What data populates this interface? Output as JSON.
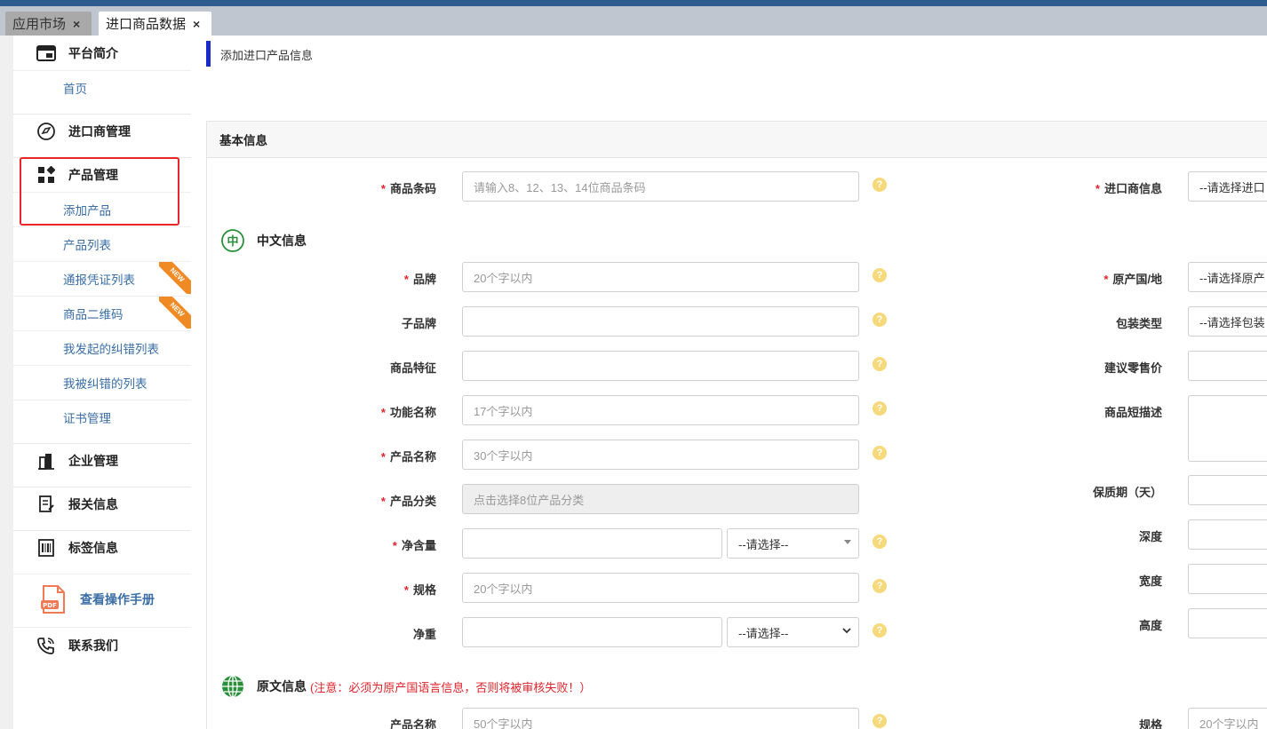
{
  "tabs": [
    {
      "label": "应用市场",
      "close": "×"
    },
    {
      "label": "进口商品数据",
      "close": "×"
    }
  ],
  "sidebar": {
    "sections": [
      {
        "label": "平台简介",
        "icon": "layout-window-icon"
      },
      {
        "label": "进口商管理",
        "icon": "compass-circle-icon"
      },
      {
        "label": "产品管理",
        "icon": "grid-blocks-icon"
      },
      {
        "label": "企业管理",
        "icon": "building-icon"
      },
      {
        "label": "报关信息",
        "icon": "document-pen-icon"
      },
      {
        "label": "标签信息",
        "icon": "barcode-icon"
      },
      {
        "label": "联系我们",
        "icon": "phone-icon"
      }
    ],
    "items": {
      "home": "首页",
      "add_product": "添加产品",
      "product_list": "产品列表",
      "notice_list": "通报凭证列表",
      "qrcode": "商品二维码",
      "my_corrections": "我发起的纠错列表",
      "corrected_me": "我被纠错的列表",
      "certificates": "证书管理"
    },
    "badge_new": "NEW",
    "manual": "查看操作手册",
    "manual_icon_text": "PDF"
  },
  "main": {
    "title": "添加进口产品信息",
    "section_title": "基本信息",
    "help_glyph": "?",
    "required_mark": "*",
    "left_fields": {
      "barcode": {
        "label": "商品条码",
        "placeholder": "请输入8、12、13、14位商品条码"
      },
      "brand": {
        "label": "品牌",
        "placeholder": "20个字以内"
      },
      "sub_brand": {
        "label": "子品牌",
        "placeholder": ""
      },
      "feature": {
        "label": "商品特征",
        "placeholder": ""
      },
      "func_name": {
        "label": "功能名称",
        "placeholder": "17个字以内"
      },
      "product_name": {
        "label": "产品名称",
        "placeholder": "30个字以内"
      },
      "category": {
        "label": "产品分类",
        "placeholder": "点击选择8位产品分类"
      },
      "net_content": {
        "label": "净含量",
        "placeholder": "",
        "select": "--请选择--"
      },
      "spec": {
        "label": "规格",
        "placeholder": "20个字以内"
      },
      "net_weight": {
        "label": "净重",
        "placeholder": "",
        "select": "--请选择--"
      }
    },
    "right_fields": {
      "importer": {
        "label": "进口商信息",
        "value": "--请选择进口"
      },
      "origin": {
        "label": "原产国/地",
        "value": "--请选择原产"
      },
      "package": {
        "label": "包装类型",
        "value": "--请选择包装"
      },
      "price": {
        "label": "建议零售价",
        "value": ""
      },
      "short_desc": {
        "label": "商品短描述",
        "value": ""
      },
      "shelf_life": {
        "label": "保质期（天）",
        "value": ""
      },
      "depth": {
        "label": "深度",
        "value": ""
      },
      "width": {
        "label": "宽度",
        "value": ""
      },
      "height": {
        "label": "高度",
        "value": ""
      }
    },
    "chinese_section": {
      "icon_text": "中",
      "title": "中文信息"
    },
    "original_section": {
      "title": "原文信息",
      "warning": "(注意：必须为原产国语言信息，否则将被审核失败！）"
    },
    "original_fields": {
      "product_name": {
        "label": "产品名称",
        "placeholder": "50个字以内"
      },
      "spec": {
        "label": "规格",
        "placeholder": "20个字以内"
      }
    }
  }
}
